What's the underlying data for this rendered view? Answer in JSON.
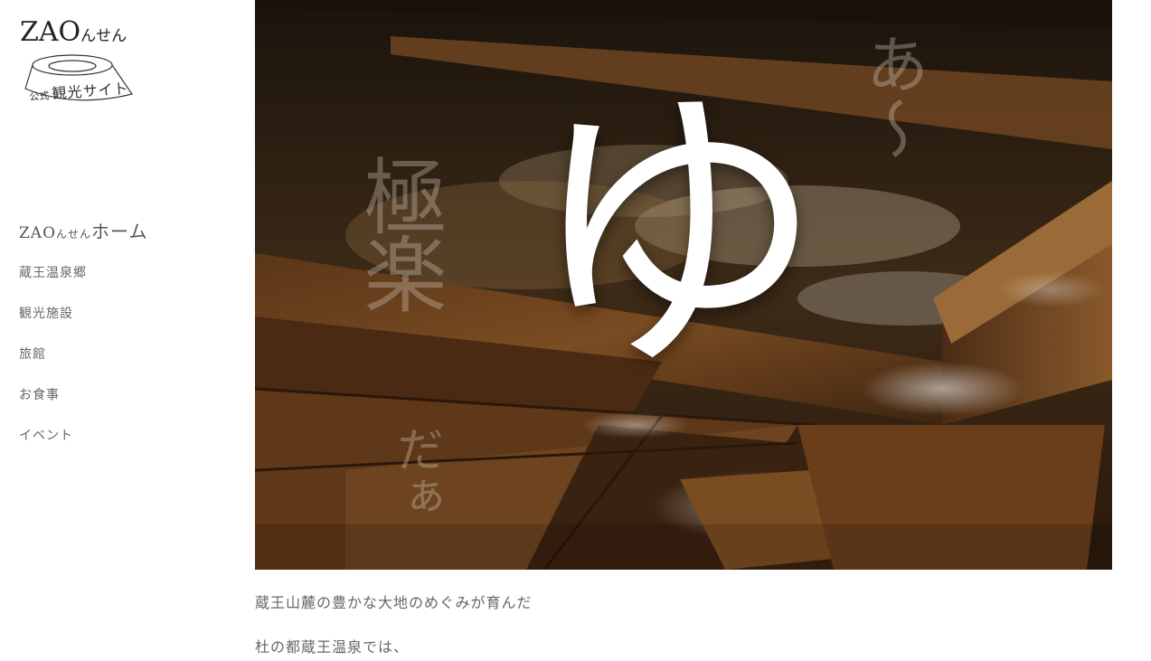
{
  "logo": {
    "main_zao": "ZAO",
    "main_onsen": "んせん",
    "sub_small": "公式",
    "sub_big": "観光サイト"
  },
  "nav": {
    "home_zao": "ZAO",
    "home_onsen": "んせん",
    "home_suffix": "ホーム",
    "items": [
      {
        "label": "蔵王温泉郷"
      },
      {
        "label": "観光施設"
      },
      {
        "label": "旅館"
      },
      {
        "label": "お食事"
      },
      {
        "label": "イベント"
      }
    ]
  },
  "hero": {
    "big_char": "ゆ",
    "vertical_left": "極楽",
    "vertical_left_small": "だぁ",
    "vertical_right": "あ〜"
  },
  "intro": {
    "lines": [
      "蔵王山麓の豊かな大地のめぐみが育んだ",
      "杜の都蔵王温泉では、"
    ]
  },
  "colors": {
    "text": "#555555",
    "wood_dark": "#2a1c10",
    "wood_mid": "#6b4524",
    "highlight": "#ffffff"
  }
}
